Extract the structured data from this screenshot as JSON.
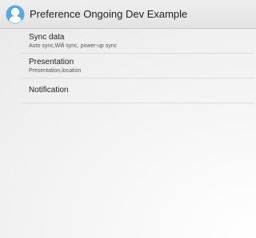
{
  "app": {
    "title": "Preference Ongoing Dev Example",
    "icon": "user-avatar-icon",
    "icon_color": "#5aa8e0"
  },
  "preferences": [
    {
      "title": "Sync data",
      "summary": "Auto sync,Wifi sync, power-up sync"
    },
    {
      "title": "Presentation",
      "summary": "Presentation,location"
    },
    {
      "title": "Notification",
      "summary": ""
    }
  ]
}
